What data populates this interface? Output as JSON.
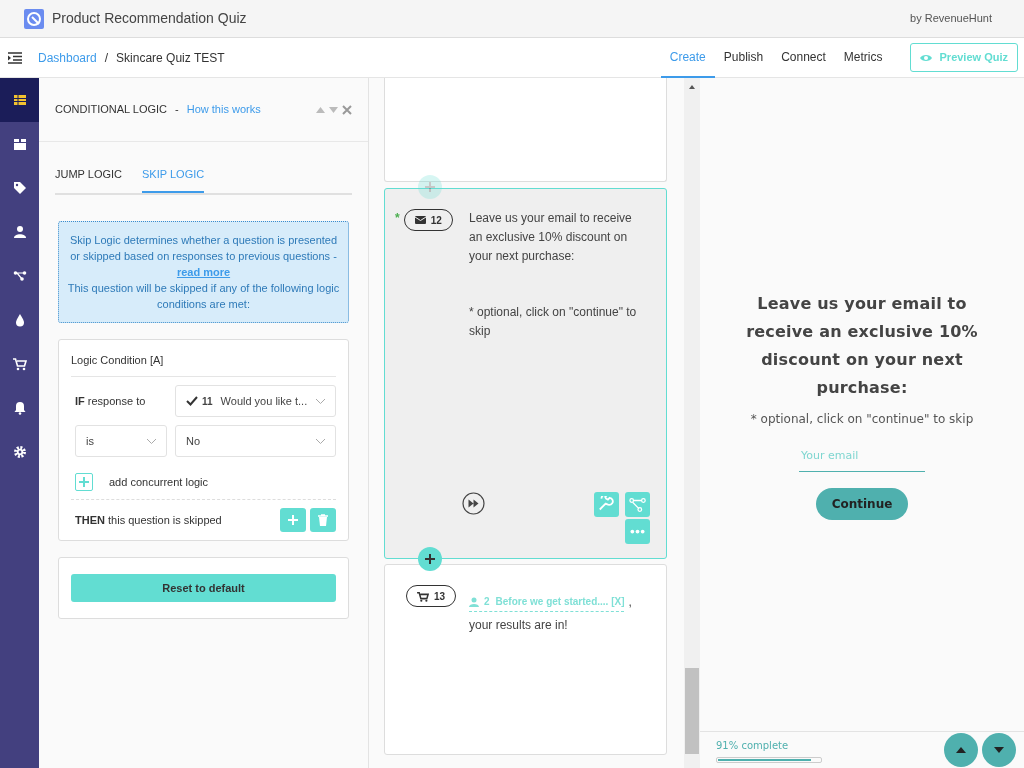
{
  "app": {
    "title": "Product Recommendation Quiz",
    "byline": "by RevenueHunt"
  },
  "breadcrumb": {
    "link": "Dashboard",
    "separator": "/",
    "current": "Skincare Quiz TEST"
  },
  "nav_tabs": [
    {
      "label": "Create",
      "selected": true
    },
    {
      "label": "Publish",
      "selected": false
    },
    {
      "label": "Connect",
      "selected": false
    },
    {
      "label": "Metrics",
      "selected": false
    }
  ],
  "preview_button": "Preview Quiz",
  "sidebar": {
    "items": [
      {
        "selected": true
      },
      {
        "selected": false
      },
      {
        "selected": false
      },
      {
        "selected": false
      },
      {
        "selected": false
      },
      {
        "selected": false
      },
      {
        "selected": false
      },
      {
        "selected": false
      },
      {
        "selected": false
      }
    ]
  },
  "panel": {
    "title": "CONDITIONAL LOGIC",
    "separator": "-",
    "help_link": "How this works",
    "tabs": [
      {
        "label": "JUMP LOGIC",
        "selected": false
      },
      {
        "label": "SKIP LOGIC",
        "selected": true
      }
    ],
    "info": {
      "intro": "Skip Logic determines whether a question is presented or skipped based on responses to previous questions - ",
      "link": "read more",
      "outro": "This question will be skipped if any of the following logic conditions are met:"
    },
    "condition": {
      "title": "Logic Condition [A]",
      "if_label": "**IF** response to",
      "question_number": "11",
      "question_text": "Would you like t...",
      "operator": "is",
      "value": "No",
      "add_label": "add concurrent logic",
      "then_label": "**THEN** this question is skipped"
    },
    "reset_button": "Reset to default"
  },
  "questions": [
    {
      "kind": "blank",
      "selected": false
    },
    {
      "kind": "email",
      "selected": true,
      "required_mark": "*",
      "number": "12",
      "text": "Leave us your email to receive an exclusive 10% discount on your next purchase:",
      "note": "* optional, click on \"continue\" to skip"
    },
    {
      "kind": "products",
      "selected": false,
      "number": "13",
      "chip_number": "2",
      "chip_text": "Before we get started.... [X]",
      "suffix": ",",
      "text": "your results are in!"
    }
  ],
  "preview": {
    "heading": "Leave us your email to receive an exclusive 10% discount on your next purchase:",
    "note": "* optional, click on \"continue\" to skip",
    "placeholder": "Your email",
    "button": "Continue",
    "progress_text": "91% complete",
    "level": 0.91
  }
}
